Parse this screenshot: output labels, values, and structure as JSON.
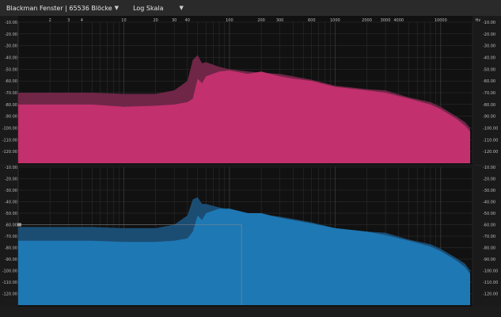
{
  "toolbar": {
    "window_label": "Blackman Fenster | 65536 Blöcke",
    "scale_label": "Log Skala"
  },
  "colors": {
    "top_fill": "#c2306d",
    "top_peak": "#6f2647",
    "bottom_fill": "#1e78b4",
    "bottom_peak": "#1b4d73",
    "grid": "#3a3a3a",
    "plot_bg": "#121212"
  },
  "chart_data": [
    {
      "type": "area",
      "x_scale": "log",
      "xlim": [
        1,
        20000
      ],
      "x_ticks": [
        "2",
        "3",
        "4",
        "10",
        "20",
        "30",
        "40",
        "100",
        "200",
        "300",
        "600",
        "1000",
        "2000",
        "3000",
        "4000",
        "10000"
      ],
      "x_tick_values": [
        2,
        3,
        4,
        10,
        20,
        30,
        40,
        100,
        200,
        300,
        600,
        1000,
        2000,
        3000,
        4000,
        10000
      ],
      "x_unit": "Hz",
      "ylim": [
        -130,
        -10
      ],
      "y_ticks": [
        "-10.00",
        "-20.00",
        "-30.00",
        "-40.00",
        "-50.00",
        "-60.00",
        "-70.00",
        "-80.00",
        "-90.00",
        "-100.00",
        "-110.00",
        "-120.00"
      ],
      "y_tick_values": [
        -10,
        -20,
        -30,
        -40,
        -50,
        -60,
        -70,
        -80,
        -90,
        -100,
        -110,
        -120
      ],
      "series": [
        {
          "role": "peak",
          "x": [
            1,
            5,
            10,
            20,
            30,
            40,
            45,
            50,
            55,
            60,
            80,
            100,
            150,
            200,
            300,
            400,
            600,
            1000,
            2000,
            3000,
            5000,
            8000,
            10000,
            14000,
            17000,
            19000
          ],
          "values": [
            -70,
            -70,
            -71,
            -71,
            -68,
            -60,
            -42,
            -38,
            -45,
            -44,
            -48,
            -50,
            -52,
            -53,
            -54,
            -56,
            -59,
            -64,
            -67,
            -68,
            -74,
            -78,
            -82,
            -90,
            -95,
            -100
          ]
        },
        {
          "role": "fill",
          "x": [
            1,
            5,
            10,
            20,
            30,
            40,
            45,
            50,
            55,
            60,
            80,
            100,
            150,
            200,
            300,
            400,
            600,
            1000,
            2000,
            3000,
            5000,
            8000,
            10000,
            14000,
            17000,
            19000
          ],
          "values": [
            -80,
            -80,
            -82,
            -81,
            -80,
            -78,
            -75,
            -58,
            -62,
            -56,
            -52,
            -51,
            -54,
            -52,
            -56,
            -58,
            -60,
            -65,
            -68,
            -70,
            -75,
            -80,
            -84,
            -92,
            -98,
            -103
          ]
        }
      ]
    },
    {
      "type": "area",
      "x_scale": "log",
      "xlim": [
        1,
        20000
      ],
      "x_ticks": [
        "2",
        "3",
        "4",
        "10",
        "20",
        "30",
        "40",
        "100",
        "200",
        "300",
        "600",
        "1000",
        "2000",
        "3000",
        "4000",
        "10000"
      ],
      "x_tick_values": [
        2,
        3,
        4,
        10,
        20,
        30,
        40,
        100,
        200,
        300,
        600,
        1000,
        2000,
        3000,
        4000,
        10000
      ],
      "x_unit": "Hz",
      "ylim": [
        -130,
        -10
      ],
      "y_ticks": [
        "-10.00",
        "-20.00",
        "-30.00",
        "-40.00",
        "-50.00",
        "-60.00",
        "-70.00",
        "-80.00",
        "-90.00",
        "-100.00",
        "-110.00",
        "-120.00"
      ],
      "y_tick_values": [
        -10,
        -20,
        -30,
        -40,
        -50,
        -60,
        -70,
        -80,
        -90,
        -100,
        -110,
        -120
      ],
      "series": [
        {
          "role": "peak",
          "x": [
            1,
            5,
            10,
            20,
            30,
            40,
            45,
            50,
            55,
            60,
            80,
            100,
            150,
            200,
            300,
            400,
            600,
            1000,
            2000,
            3000,
            5000,
            8000,
            10000,
            14000,
            17000,
            19000
          ],
          "values": [
            -62,
            -62,
            -63,
            -63,
            -60,
            -52,
            -38,
            -36,
            -42,
            -42,
            -45,
            -47,
            -50,
            -51,
            -53,
            -55,
            -58,
            -63,
            -66,
            -67,
            -73,
            -77,
            -81,
            -89,
            -94,
            -100
          ]
        },
        {
          "role": "fill",
          "x": [
            1,
            5,
            10,
            20,
            30,
            40,
            45,
            50,
            55,
            60,
            80,
            100,
            150,
            200,
            300,
            400,
            600,
            1000,
            2000,
            3000,
            5000,
            8000,
            10000,
            14000,
            17000,
            19000
          ],
          "values": [
            -74,
            -74,
            -75,
            -75,
            -74,
            -72,
            -66,
            -52,
            -56,
            -50,
            -46,
            -46,
            -50,
            -50,
            -54,
            -56,
            -59,
            -63,
            -66,
            -69,
            -74,
            -79,
            -83,
            -91,
            -97,
            -103
          ]
        }
      ]
    }
  ]
}
